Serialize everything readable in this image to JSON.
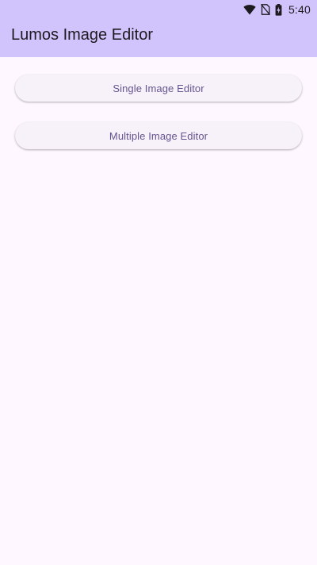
{
  "status_bar": {
    "time": "5:40",
    "icons": [
      "wifi-icon",
      "no-sim-icon",
      "battery-charging-icon"
    ]
  },
  "app_bar": {
    "title": "Lumos Image Editor",
    "color": "#d1c3fb"
  },
  "actions": {
    "single_label": "Single Image Editor",
    "multiple_label": "Multiple Image Editor"
  },
  "colors": {
    "background": "#fef7ff",
    "button_bg": "#f7f2fa",
    "button_text": "#65558f",
    "title_text": "#1d1b20"
  }
}
